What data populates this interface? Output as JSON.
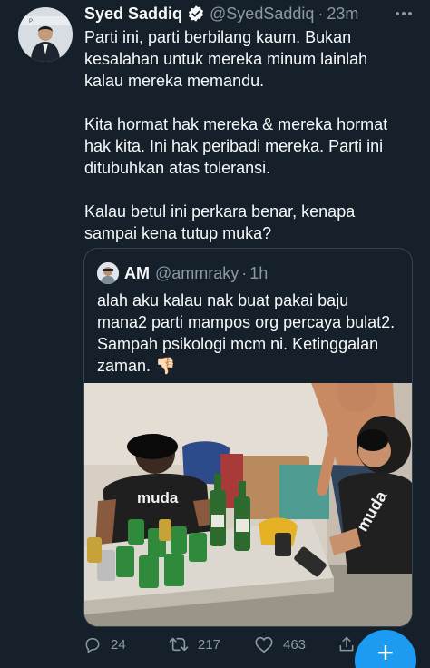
{
  "tweet": {
    "display_name": "Syed Saddiq",
    "handle": "@SyedSaddiq",
    "separator": "·",
    "time": "23m",
    "paragraphs": [
      "Parti ini, parti berbilang kaum. Bukan kesalahan untuk mereka minum lainlah kalau mereka memandu.",
      "Kita hormat hak mereka & mereka hormat hak kita. Ini hak peribadi mereka. Parti ini ditubuhkan atas toleransi.",
      "Kalau betul ini perkara benar, kenapa sampai kena tutup muka?"
    ]
  },
  "quoted_tweet": {
    "display_name": "AM",
    "handle": "@ammraky",
    "separator": "·",
    "time": "1h",
    "text": "alah aku kalau nak buat pakai baju mana2 parti mampos org percaya bulat2. Sampah psikologi mcm ni. Ketinggalan zaman. 👎🏻",
    "photo_shirt_text": "muda"
  },
  "actions": {
    "reply_count": "24",
    "retweet_count": "217",
    "like_count": "463"
  },
  "fab": {
    "label": "+"
  },
  "colors": {
    "background": "#15202b",
    "text": "#f7f9f9",
    "muted": "#8b98a5",
    "border": "#38444d",
    "accent": "#1d9bf0"
  },
  "icons": [
    "verified-badge-icon",
    "more-icon",
    "reply-icon",
    "retweet-icon",
    "like-icon",
    "share-icon"
  ]
}
